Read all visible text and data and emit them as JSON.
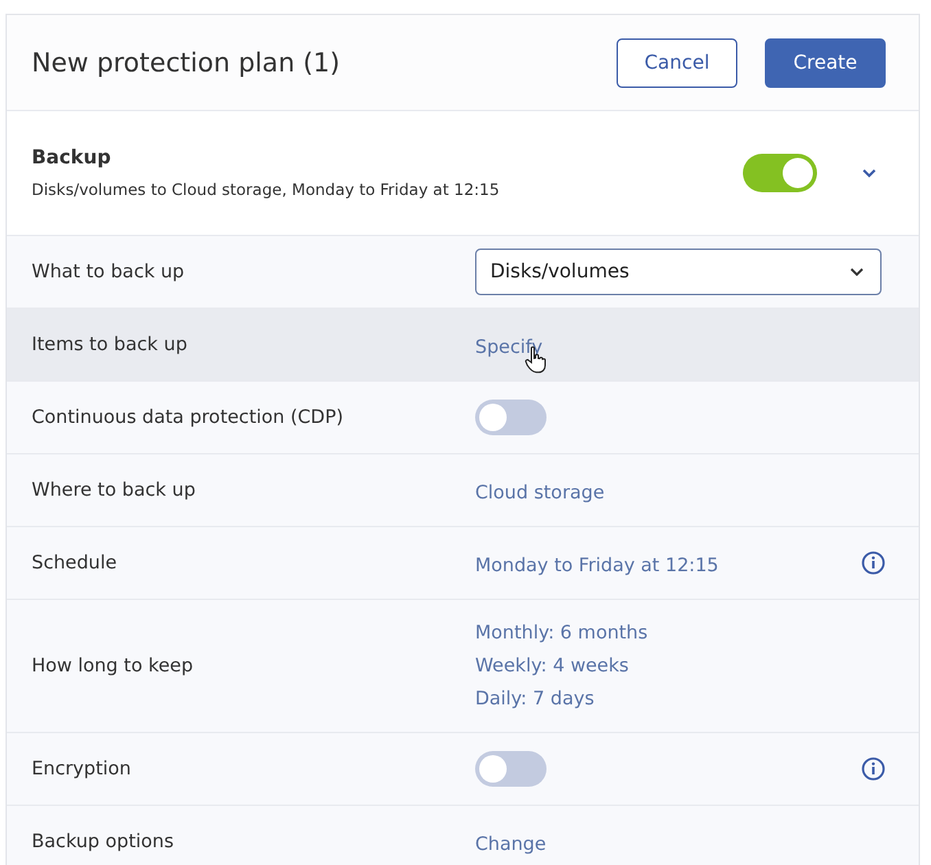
{
  "header": {
    "title": "New protection plan (1)",
    "buttons": [
      {
        "label": "Cancel",
        "kind": "secondary"
      },
      {
        "label": "Create",
        "kind": "primary"
      }
    ]
  },
  "section": {
    "title": "Backup",
    "summary": "Disks/volumes to Cloud storage, Monday to Friday at 12:15",
    "on": true,
    "expanded": true
  },
  "rows": [
    {
      "kind": "select",
      "label": "What to back up",
      "value": "Disks/volumes"
    },
    {
      "kind": "link",
      "label": "Items to back up",
      "value": "Specify",
      "hovered": true
    },
    {
      "kind": "toggle",
      "label": "Continuous data protection (CDP)",
      "on": false
    },
    {
      "kind": "link",
      "label": "Where to back up",
      "value": "Cloud storage"
    },
    {
      "kind": "link",
      "label": "Schedule",
      "value": "Monday to Friday at 12:15",
      "info": true
    },
    {
      "kind": "lines",
      "label": "How long to keep",
      "lines": [
        "Monthly: 6 months",
        "Weekly: 4 weeks",
        "Daily: 7 days"
      ]
    },
    {
      "kind": "toggle",
      "label": "Encryption",
      "on": false,
      "info": true
    },
    {
      "kind": "link",
      "label": "Backup options",
      "value": "Change"
    }
  ]
}
